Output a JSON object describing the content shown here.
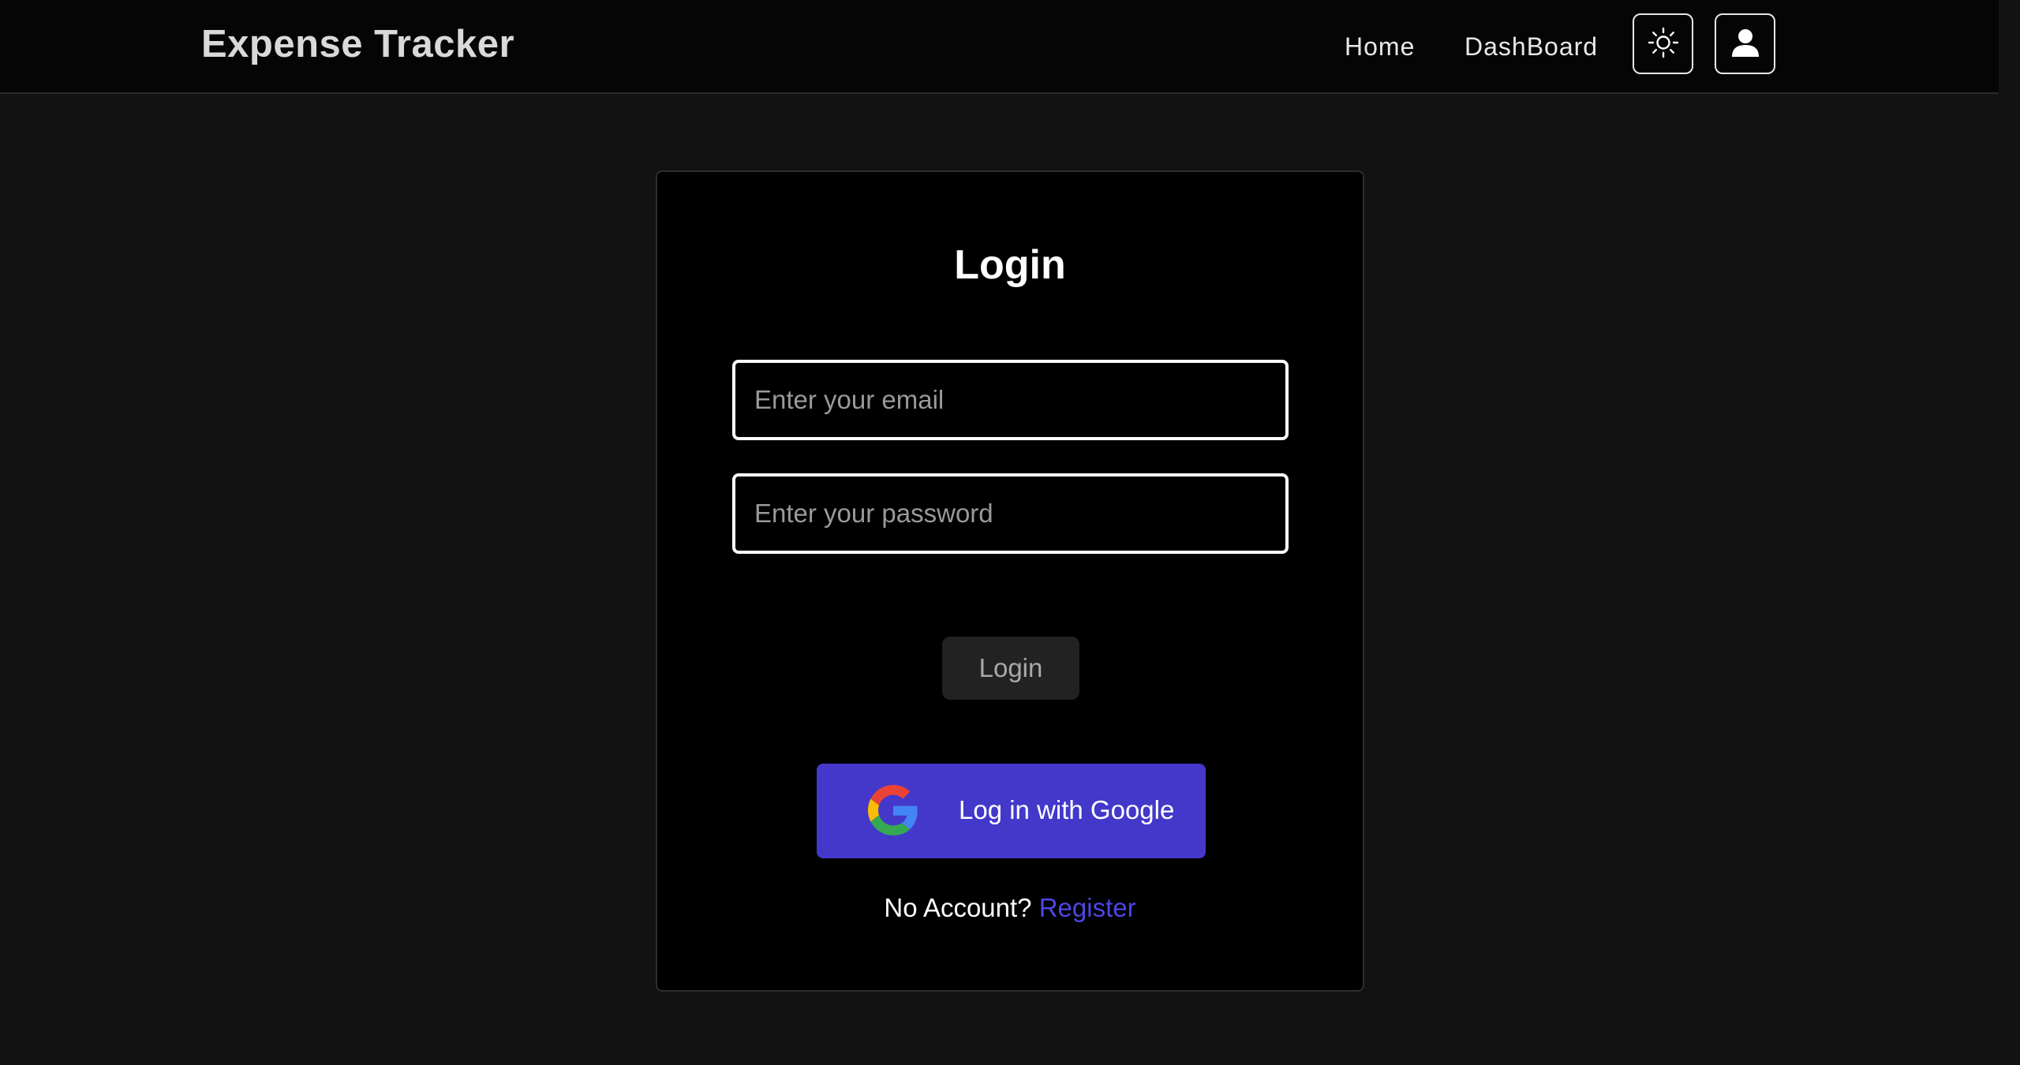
{
  "navbar": {
    "brand": "Expense Tracker",
    "links": [
      {
        "label": "Home"
      },
      {
        "label": "DashBoard"
      }
    ],
    "theme_toggle_icon": "sun-icon",
    "account_icon": "user-icon"
  },
  "login": {
    "title": "Login",
    "email_placeholder": "Enter your email",
    "email_value": "",
    "password_placeholder": "Enter your password",
    "password_value": "",
    "submit_label": "Login",
    "google_label": "Log in with Google",
    "no_account_text": "No Account?",
    "register_link": "Register"
  },
  "colors": {
    "background": "#121212",
    "navbar": "#050505",
    "card": "#000000",
    "accent": "#4338ca",
    "link": "#4f46e5"
  }
}
